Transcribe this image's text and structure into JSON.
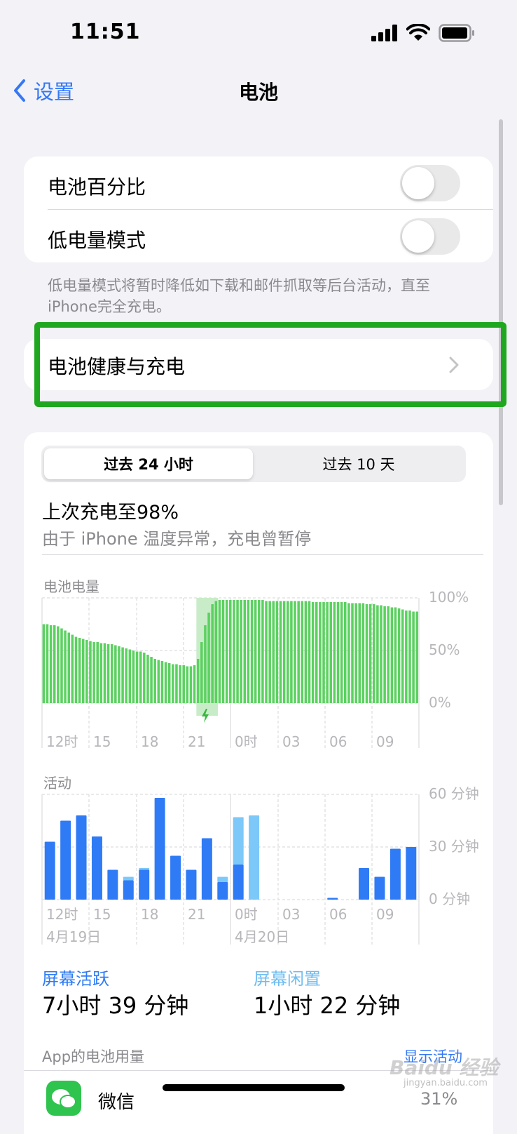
{
  "status_bar": {
    "time": "11:51"
  },
  "nav": {
    "back_label": "设置",
    "title": "电池"
  },
  "settings": {
    "battery_percentage": "电池百分比",
    "low_power_mode": "低电量模式",
    "low_power_note": "低电量模式将暂时降低如下载和邮件抓取等后台活动，直至iPhone完全充电。",
    "battery_health": "电池健康与充电"
  },
  "usage": {
    "tabs": [
      {
        "label": "过去 24 小时",
        "active": true
      },
      {
        "label": "过去 10 天",
        "active": false
      }
    ],
    "last_charged": "上次充电至98%",
    "charge_note": "由于 iPhone 温度异常，充电曾暂停",
    "screen_on_label": "屏幕活跃",
    "screen_on_value": "7小时 39 分钟",
    "screen_off_label": "屏幕闲置",
    "screen_off_value": "1小时 22 分钟"
  },
  "chart_data": [
    {
      "type": "bar",
      "title": "电池电量",
      "x_tick_labels": [
        "12时",
        "15",
        "18",
        "21",
        "0时",
        "03",
        "06",
        "09"
      ],
      "y_tick_labels": [
        "100%",
        "50%",
        "0%"
      ],
      "ylim": [
        0,
        100
      ],
      "charging_segment": [
        28,
        31
      ],
      "values": [
        75,
        75,
        74,
        74,
        73,
        71,
        69,
        67,
        65,
        63,
        62,
        61,
        60,
        59,
        58,
        58,
        57,
        57,
        56,
        56,
        55,
        54,
        53,
        52,
        51,
        50,
        49,
        49,
        48,
        46,
        44,
        42,
        41,
        40,
        39,
        38,
        37,
        37,
        36,
        36,
        35,
        35,
        36,
        42,
        58,
        74,
        86,
        94,
        97,
        98,
        98,
        98,
        98,
        98,
        98,
        98,
        98,
        98,
        98,
        98,
        98,
        98,
        97,
        97,
        97,
        97,
        97,
        97,
        97,
        97,
        97,
        97,
        97,
        97,
        97,
        96,
        96,
        96,
        96,
        96,
        96,
        96,
        96,
        96,
        96,
        95,
        95,
        95,
        95,
        95,
        94,
        94,
        94,
        93,
        93,
        92,
        92,
        91,
        91,
        90,
        89,
        88,
        88,
        87,
        87
      ]
    },
    {
      "type": "bar",
      "title": "活动",
      "x_tick_labels": [
        "12时",
        "15",
        "18",
        "21",
        "0时",
        "03",
        "06",
        "09"
      ],
      "day_labels": [
        "4月19日",
        "4月20日"
      ],
      "y_tick_labels": [
        "60 分钟",
        "30 分钟",
        "0 分钟"
      ],
      "ylim": [
        0,
        60
      ],
      "series": [
        {
          "name": "屏幕活跃",
          "values": [
            33,
            45,
            48,
            36,
            17,
            11,
            17,
            58,
            25,
            17,
            35,
            10,
            20,
            0,
            0,
            0,
            0,
            0,
            1,
            0,
            18,
            13,
            29,
            30
          ]
        },
        {
          "name": "屏幕闲置",
          "values": [
            0,
            0,
            0,
            0,
            0,
            2,
            1,
            0,
            0,
            0,
            0,
            3,
            27,
            48,
            0,
            0,
            0,
            0,
            0,
            0,
            0,
            0,
            0,
            0
          ]
        }
      ],
      "colors": {
        "active": "#2f7bf5",
        "idle": "#7cc8f8"
      }
    }
  ],
  "app_usage": {
    "header": "App的电池用量",
    "show_activity": "显示活动",
    "first_app": {
      "name": "微信",
      "percent": "31%"
    }
  },
  "watermark": {
    "brand": "Baidu 经验",
    "site": "jingyan.baidu.com"
  }
}
